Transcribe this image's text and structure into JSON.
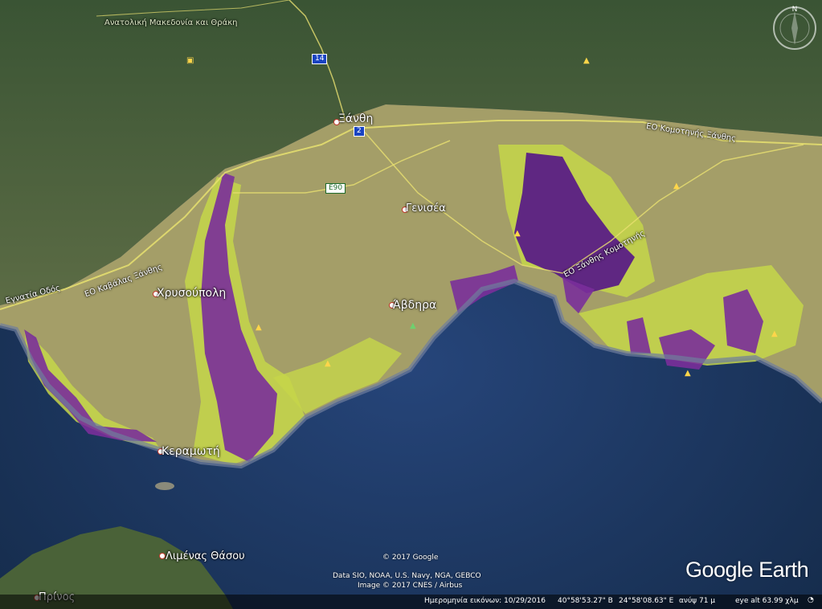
{
  "map": {
    "region_label": "Ανατολική Μακεδονία και Θράκη",
    "cities": {
      "xanthi": "Ξάνθη",
      "chrysoupoli": "Χρυσούπολη",
      "genisea": "Γενισέα",
      "avdira": "Άβδηρα",
      "keramoti": "Κεραμωτή",
      "limenas": "Λιμένας Θάσου",
      "prinos": "Πρίνος"
    },
    "roads": {
      "egnatia": "Εγνατία Οδός",
      "kavala_xanthi": "ΕΟ Καβάλας Ξάνθης",
      "xanthi_komotini": "ΕΟ Ξάνθης Κομοτηνής",
      "komotini_xanthi": "ΕΟ Κομοτηνής Ξάνθης"
    },
    "shields": {
      "road14": "14",
      "road2": "2",
      "e90": "E90"
    },
    "compass_letter": "N",
    "colors": {
      "sea": "#1c3354",
      "protected_area": "#7a2f9a",
      "buffer_zone": "#c6d64a",
      "plain": "#a49e68",
      "mountains": "#3f5a35"
    }
  },
  "attribution": {
    "copyright": "© 2017 Google",
    "data": "Data SIO, NOAA, U.S. Navy, NGA, GEBCO",
    "image": "Image © 2017 CNES / Airbus"
  },
  "logo": "Google Earth",
  "status": {
    "imagery_date": "Ημερομηνία εικόνων: 10/29/2016",
    "lat": "40°58'53.27\" Β",
    "lon": "24°58'08.63\" Ε",
    "elev": "ανύψ   71 μ",
    "eye_alt": "eye alt  63.99 χλμ"
  }
}
